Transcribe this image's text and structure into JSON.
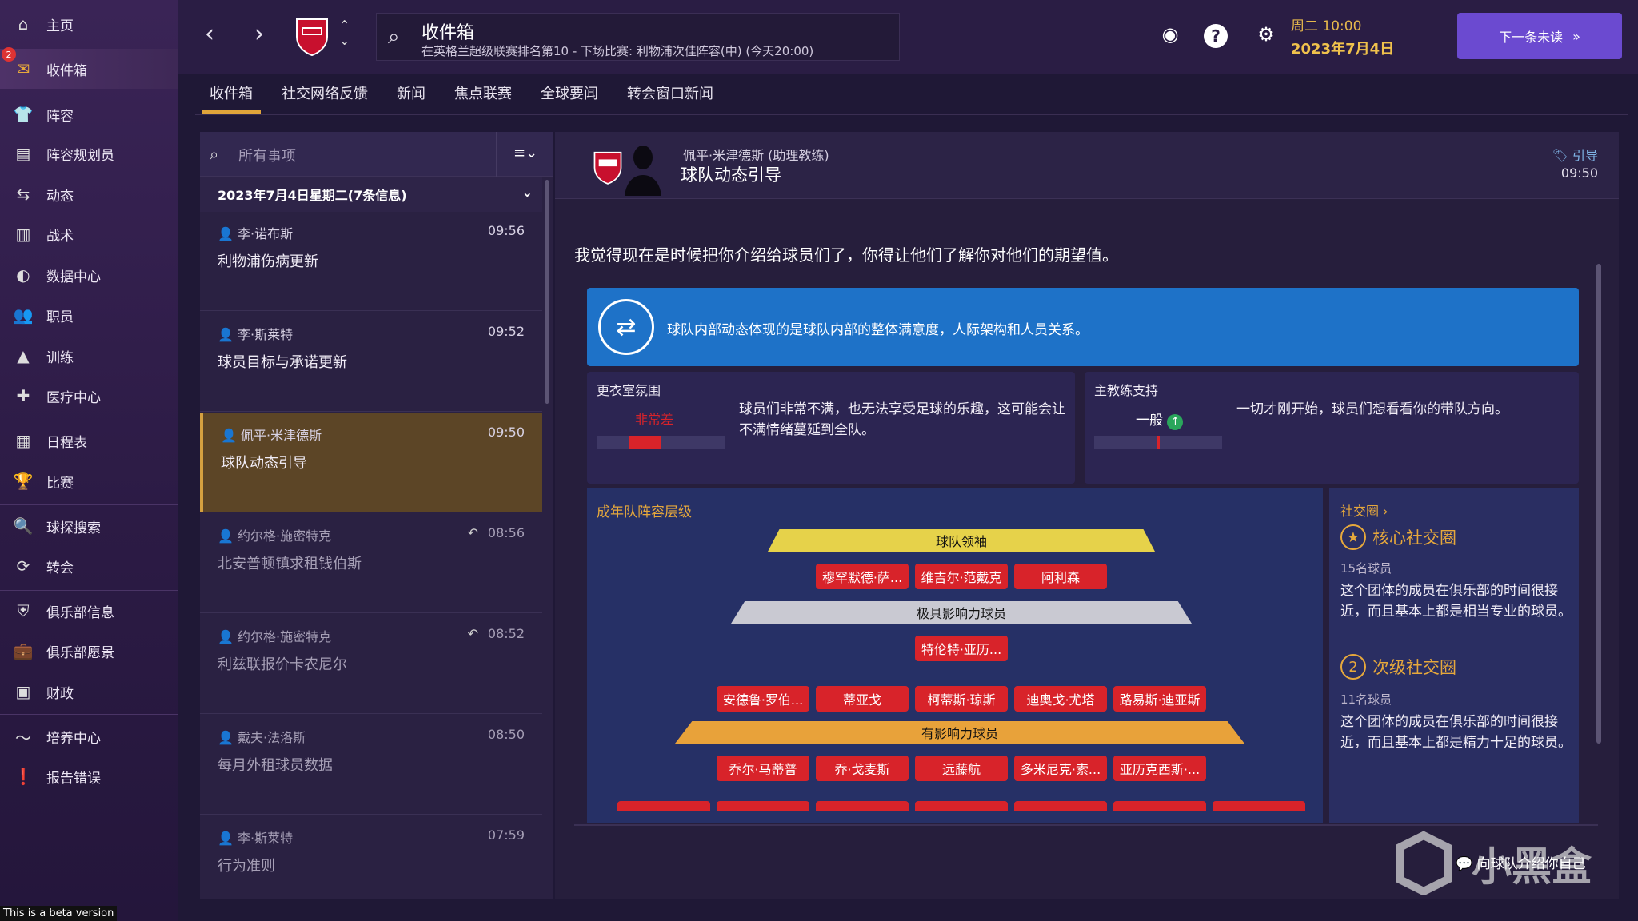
{
  "sidebar": {
    "items": [
      {
        "label": "主页",
        "icon": "home-icon"
      },
      {
        "label": "收件箱",
        "icon": "inbox-icon",
        "badge": "2"
      },
      {
        "label": "阵容",
        "icon": "shirt-icon"
      },
      {
        "label": "阵容规划员",
        "icon": "clipboard-icon"
      },
      {
        "label": "动态",
        "icon": "dynamics-icon"
      },
      {
        "label": "战术",
        "icon": "tactics-icon"
      },
      {
        "label": "数据中心",
        "icon": "data-icon"
      },
      {
        "label": "职员",
        "icon": "staff-icon"
      },
      {
        "label": "训练",
        "icon": "training-icon"
      },
      {
        "label": "医疗中心",
        "icon": "medical-icon"
      },
      {
        "label": "日程表",
        "icon": "calendar-icon"
      },
      {
        "label": "比赛",
        "icon": "trophy-icon"
      },
      {
        "label": "球探搜索",
        "icon": "scout-search-icon"
      },
      {
        "label": "转会",
        "icon": "transfer-icon"
      },
      {
        "label": "俱乐部信息",
        "icon": "shield-icon"
      },
      {
        "label": "俱乐部愿景",
        "icon": "vision-icon"
      },
      {
        "label": "财政",
        "icon": "finance-icon"
      },
      {
        "label": "培养中心",
        "icon": "development-icon"
      },
      {
        "label": "报告错误",
        "icon": "bug-report-icon"
      }
    ],
    "beta": "This is a beta version"
  },
  "topbar": {
    "title": "收件箱",
    "subtitle": "在英格兰超级联赛排名第10 - 下场比赛: 利物浦次佳阵容(中) (今天20:00)",
    "day": "周二 10:00",
    "date": "2023年7月4日",
    "next_label": "下一条未读"
  },
  "tabs": [
    "收件箱",
    "社交网络反馈",
    "新闻",
    "焦点联赛",
    "全球要闻",
    "转会窗口新闻"
  ],
  "inbox": {
    "search_placeholder": "所有事项",
    "date_header": "2023年7月4日星期二(7条信息)",
    "messages": [
      {
        "from": "李·诺布斯",
        "time": "09:56",
        "subject": "利物浦伤病更新"
      },
      {
        "from": "李·斯莱特",
        "time": "09:52",
        "subject": "球员目标与承诺更新"
      },
      {
        "from": "佩平·米津德斯",
        "time": "09:50",
        "subject": "球队动态引导"
      },
      {
        "from": "约尔格·施密特克",
        "time": "08:56",
        "subject": "北安普顿镇求租钱伯斯"
      },
      {
        "from": "约尔格·施密特克",
        "time": "08:52",
        "subject": "利兹联报价卡农尼尔"
      },
      {
        "from": "戴夫·法洛斯",
        "time": "08:50",
        "subject": "每月外租球员数据"
      },
      {
        "from": "李·斯莱特",
        "time": "07:59",
        "subject": "行为准则"
      }
    ]
  },
  "detail": {
    "sender": "佩平·米津德斯 (助理教练)",
    "subject": "球队动态引导",
    "tag": "引导",
    "time": "09:50",
    "intro": "我觉得现在是时候把你介绍给球员们了，你得让他们了解你对他们的期望值。",
    "banner": "球队内部动态体现的是球队内部的整体满意度，人际架构和人员关系。",
    "dressing_room": {
      "title": "更衣室氛围",
      "rating": "非常差",
      "level": 0.25,
      "desc": "球员们非常不满，也无法享受足球的乐趣，这可能会让不满情绪蔓延到全队。",
      "color": "#d8232a"
    },
    "manager_support": {
      "title": "主教练支持",
      "rating": "一般",
      "level": 0.5,
      "desc": "一切才刚开始，球员们想看看你的带队方向。",
      "color": "#d8232a"
    },
    "hierarchy": {
      "title": "成年队阵容层级",
      "tiers": [
        {
          "label": "球队领袖",
          "color": "#e6d24a",
          "players": [
            "穆罕默德·萨...",
            "维吉尔·范戴克",
            "阿利森"
          ]
        },
        {
          "label": "极具影响力球员",
          "color": "#c9c9d2",
          "players": [
            "特伦特·亚历...",
            "安德鲁·罗伯...",
            "蒂亚戈",
            "柯蒂斯·琼斯",
            "迪奥戈·尤塔",
            "路易斯·迪亚斯"
          ]
        },
        {
          "label": "有影响力球员",
          "color": "#e8a23a",
          "players": [
            "乔尔·马蒂普",
            "乔·戈麦斯",
            "远藤航",
            "多米尼克·索...",
            "亚历克西斯·..."
          ]
        }
      ]
    },
    "social": {
      "title": "社交圈",
      "groups": [
        {
          "num": "★",
          "name": "核心社交圈",
          "count": "15名球员",
          "desc": "这个团体的成员在俱乐部的时间很接近，而且基本上都是相当专业的球员。"
        },
        {
          "num": "2",
          "name": "次级社交圈",
          "count": "11名球员",
          "desc": "这个团体的成员在俱乐部的时间很接近，而且基本上都是精力十足的球员。"
        }
      ]
    },
    "reply_hint": "向球队介绍你自己"
  },
  "watermark": "小黑盒"
}
